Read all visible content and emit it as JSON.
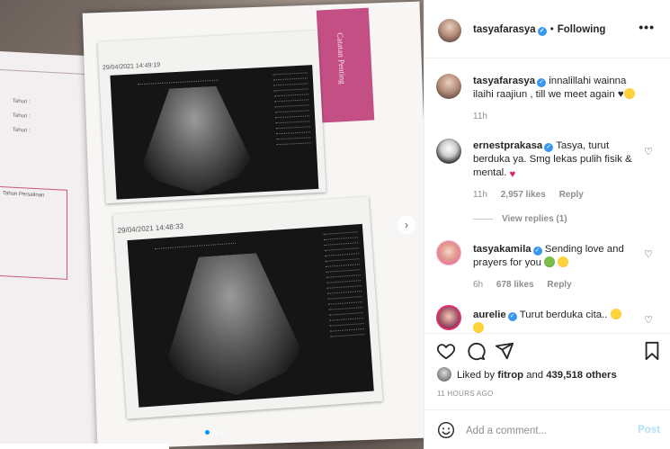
{
  "post": {
    "username": "tasyafarasya",
    "follow_status": "Following",
    "more_label": "•••"
  },
  "photo": {
    "print1_timestamp": "29/04/2021 14:49:19",
    "print2_timestamp": "29/04/2021 14:48:33",
    "tab_label": "Catatan Penting",
    "left_page_labels": [
      "Tahun :",
      "Tahun :",
      "Tahun :"
    ],
    "left_page_table_header": "Tahun Persalinan",
    "next_arrow": "›"
  },
  "comments": [
    {
      "username": "tasyafarasya",
      "text": "innalillahi wainna ilaihi raajiun , till we meet again ♥",
      "time": "11h"
    },
    {
      "username": "ernestprakasa",
      "text": "Tasya, turut berduka ya. Smg lekas pulih fisik & mental.",
      "time": "11h",
      "likes": "2,957 likes",
      "reply": "Reply",
      "view_replies": "View replies (1)"
    },
    {
      "username": "tasyakamila",
      "text": "Sending love and prayers for you",
      "time": "6h",
      "likes": "678 likes",
      "reply": "Reply"
    },
    {
      "username": "aurelie",
      "text": "Turut berduka cita..",
      "time": ""
    }
  ],
  "likes": {
    "liked_by_prefix": "Liked by",
    "liked_by_user": "fitrop",
    "and_label": "and",
    "count": "439,518 others"
  },
  "timestamp": "11 HOURS AGO",
  "add_comment": {
    "placeholder": "Add a comment...",
    "post_label": "Post"
  },
  "colors": {
    "accent_blue": "#0095f6",
    "post_disabled": "#b2dffc",
    "heart_red": "#e0245e",
    "tab_pink": "#c44f85"
  },
  "icons": [
    "heart-icon",
    "comment-icon",
    "share-icon",
    "save-icon",
    "smiley-icon",
    "verified-badge-icon",
    "more-options-icon"
  ]
}
